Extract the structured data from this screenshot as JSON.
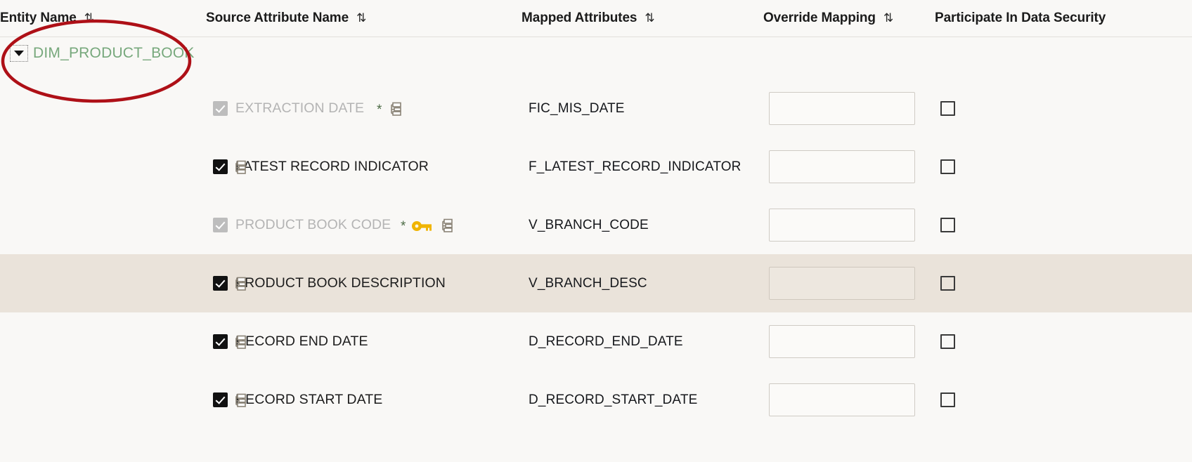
{
  "table": {
    "columns": [
      {
        "label": "Entity Name",
        "sort_icon": "sort-updown-icon",
        "sort_glyph": "⇅"
      },
      {
        "label": "Source Attribute Name",
        "sort_icon": "sort-updown-icon",
        "sort_glyph": "⇅"
      },
      {
        "label": "Mapped Attributes",
        "sort_icon": "sort-updown-icon",
        "sort_glyph": "⇅"
      },
      {
        "label": "Override Mapping",
        "sort_icon": "sort-updown-icon",
        "sort_glyph": "⇅"
      },
      {
        "label": "Participate In Data Security",
        "sort_icon": "sort-updown-icon",
        "sort_glyph": "⇅"
      }
    ],
    "entity": {
      "name": "DIM_PRODUCT_BOOK",
      "expanded": true,
      "toggle_icon": "triangle-down-icon",
      "name_color": "#77A87C"
    },
    "rows": [
      {
        "source_attribute": "EXTRACTION DATE",
        "checked": true,
        "disabled": true,
        "required": true,
        "required_marker": "*",
        "primary_key": false,
        "hierarchy_icon": "hierarchy-icon",
        "mapped_attribute": "FIC_MIS_DATE",
        "override_mapping": "",
        "participate_in_data_security": false,
        "selected": false
      },
      {
        "source_attribute": "LATEST RECORD INDICATOR",
        "checked": true,
        "disabled": false,
        "required": false,
        "required_marker": "",
        "primary_key": false,
        "hierarchy_icon": "hierarchy-icon",
        "mapped_attribute": "F_LATEST_RECORD_INDICATOR",
        "override_mapping": "",
        "participate_in_data_security": false,
        "selected": false
      },
      {
        "source_attribute": "PRODUCT BOOK CODE",
        "checked": true,
        "disabled": true,
        "required": true,
        "required_marker": "*",
        "primary_key": true,
        "key_icon": "primary-key-icon",
        "key_color": "#F0B400",
        "hierarchy_icon": "hierarchy-icon",
        "mapped_attribute": "V_BRANCH_CODE",
        "override_mapping": "",
        "participate_in_data_security": false,
        "selected": false
      },
      {
        "source_attribute": "PRODUCT BOOK DESCRIPTION",
        "checked": true,
        "disabled": false,
        "required": false,
        "required_marker": "",
        "primary_key": false,
        "hierarchy_icon": "hierarchy-icon",
        "mapped_attribute": "V_BRANCH_DESC",
        "override_mapping": "",
        "participate_in_data_security": false,
        "selected": true
      },
      {
        "source_attribute": "RECORD END DATE",
        "checked": true,
        "disabled": false,
        "required": false,
        "required_marker": "",
        "primary_key": false,
        "hierarchy_icon": "hierarchy-icon",
        "mapped_attribute": "D_RECORD_END_DATE",
        "override_mapping": "",
        "participate_in_data_security": false,
        "selected": false
      },
      {
        "source_attribute": "RECORD START DATE",
        "checked": true,
        "disabled": false,
        "required": false,
        "required_marker": "",
        "primary_key": false,
        "hierarchy_icon": "hierarchy-icon",
        "mapped_attribute": "D_RECORD_START_DATE",
        "override_mapping": "",
        "participate_in_data_security": false,
        "selected": false
      }
    ]
  },
  "annotation": {
    "shape": "ellipse",
    "color": "#AE1017",
    "target": "DIM_PRODUCT_BOOK"
  },
  "colors": {
    "background": "#F9F8F6",
    "selected_row": "#EAE3DA",
    "entity_link": "#77A87C",
    "annotation": "#AE1017",
    "key": "#F0B400"
  }
}
